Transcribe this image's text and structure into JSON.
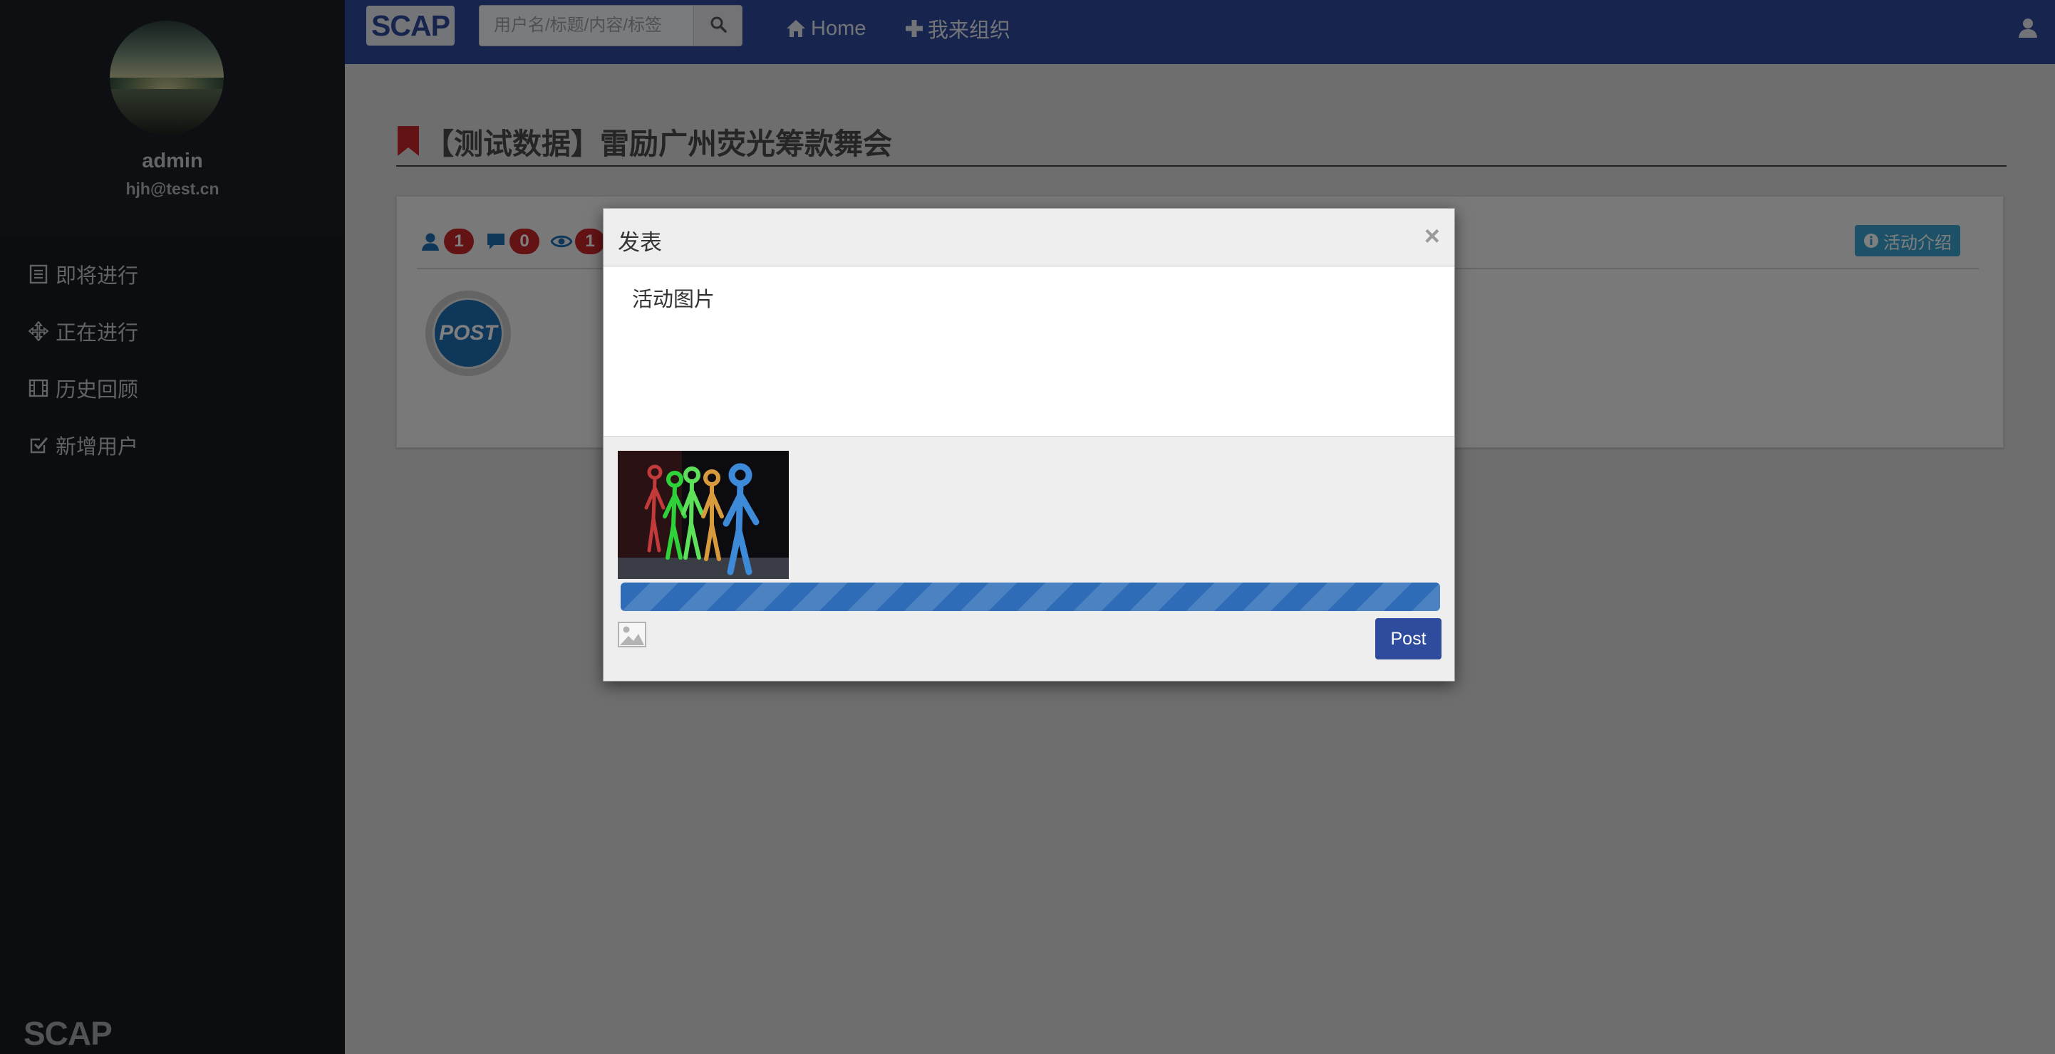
{
  "sidebar": {
    "profile": {
      "name": "admin",
      "email": "hjh@test.cn"
    },
    "items": [
      {
        "label": "即将进行",
        "icon": "list-icon"
      },
      {
        "label": "正在进行",
        "icon": "move-icon"
      },
      {
        "label": "历史回顾",
        "icon": "film-icon"
      },
      {
        "label": "新增用户",
        "icon": "check-square-icon"
      }
    ],
    "logo": "SCAP"
  },
  "header": {
    "logo": "SCAP",
    "search": {
      "placeholder": "用户名/标题/内容/标签",
      "value": ""
    },
    "links": [
      {
        "label": "Home",
        "icon": "home-icon"
      },
      {
        "label": "我来组织",
        "icon": "plus-icon"
      }
    ],
    "user_icon": "user-icon"
  },
  "page": {
    "title": "【测试数据】雷励广州荧光筹款舞会",
    "stats": {
      "participants": "1",
      "comments": "0",
      "views": "1"
    },
    "intro_button": "活动介绍",
    "post_badge": "POST"
  },
  "modal": {
    "title": "发表",
    "close": "×",
    "text": "活动图片",
    "upload_progress": 1.0,
    "post_button": "Post"
  },
  "colors": {
    "header": "#2f4b9d",
    "sidebar": "#191b22",
    "badge": "#c8262a",
    "accent": "#3aa3cf",
    "progress": "#2e6cb7"
  }
}
